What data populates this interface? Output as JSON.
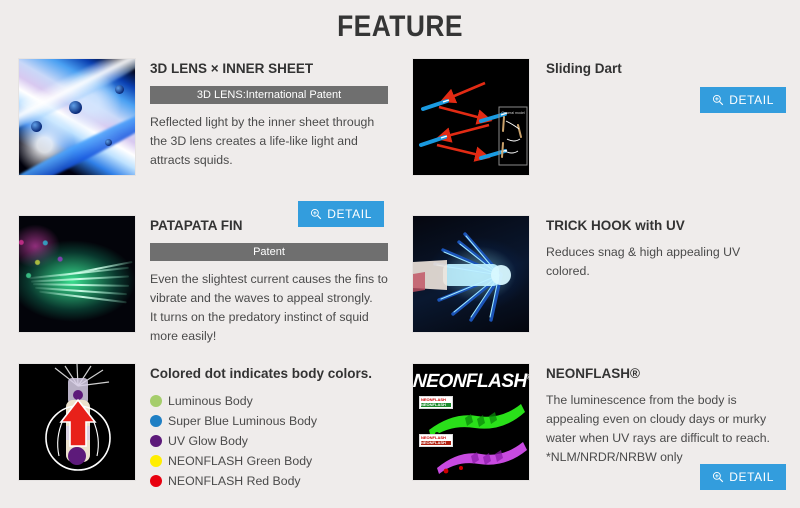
{
  "page": {
    "title": "FEATURE",
    "background_color": "#efeceb",
    "accent_color": "#339ddd",
    "badge_color": "#6f6f6f"
  },
  "detail_button": {
    "label": "DETAIL",
    "icon": "zoom-in-magnifier-icon"
  },
  "features": [
    {
      "id": "3d-lens-inner-sheet",
      "title": "3D LENS × INNER SHEET",
      "badge": "3D LENS:International Patent",
      "description": "Reflected light by the inner sheet through the 3D lens creates a life-like light and attracts squids.",
      "image_alt": "macro photo of blue iridescent 3D lens inner sheet",
      "has_detail_button": true
    },
    {
      "id": "sliding-dart",
      "title": "Sliding Dart",
      "badge": "",
      "description": "",
      "image_alt": "black diagram with red zig-zag arrows showing sliding dart action and a general model inset",
      "inset_label": "General model",
      "has_detail_button": true
    },
    {
      "id": "patapata-fin",
      "title": "PATAPATA FIN",
      "badge": "Patent",
      "description": "Even the slightest current causes the fins to vibrate and the waves to appeal strongly.\nIt turns on the predatory instinct of squid more easily!",
      "image_alt": "green glowing fin fibers on dark background",
      "has_detail_button": false
    },
    {
      "id": "trick-hook-with-uv",
      "title": "TRICK HOOK with UV",
      "badge": "",
      "description": "Reduces snag & high appealing UV colored.",
      "image_alt": "glowing blue UV trick hook crown on dark background",
      "has_detail_button": false
    },
    {
      "id": "body-colors",
      "title": "Colored dot indicates body colors.",
      "image_alt": "squid jig body with purple dots and red arrow highlighted in a white circle",
      "dots": [
        {
          "label": "Luminous Body",
          "color": "#a5cd6b"
        },
        {
          "label": "Super Blue Luminous Body",
          "color": "#1f7fc4"
        },
        {
          "label": "UV Glow Body",
          "color": "#5d1a7a"
        },
        {
          "label": "NEONFLASH Green Body",
          "color": "#ffee00"
        },
        {
          "label": "NEONFLASH Red Body",
          "color": "#e8000f"
        }
      ],
      "has_detail_button": false
    },
    {
      "id": "neonflash",
      "title": "NEONFLASH®",
      "logo_text_1": "NEON",
      "logo_text_2": "FLASH",
      "logo_mark": "®",
      "description": "The luminescence from the body is appealing even on cloudy days or murky water when UV rays are difficult to reach.\n*NLM/NRDR/NRBW only",
      "image_alt": "NEONFLASH logo with green and purple squid jig bodies on black",
      "has_detail_button": true
    }
  ]
}
